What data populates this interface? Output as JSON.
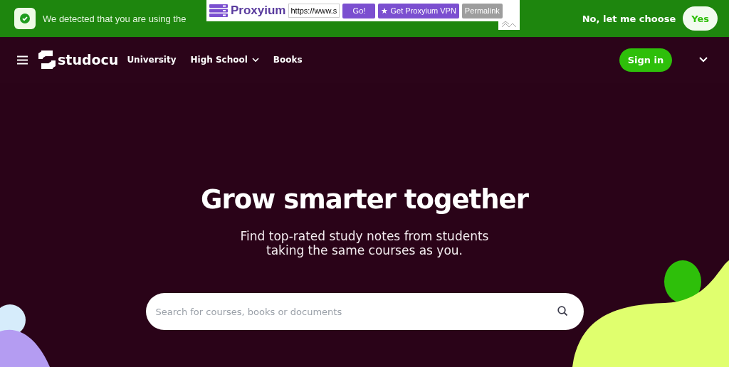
{
  "banner": {
    "message": "We detected that you are using the",
    "decline": "No, let me choose",
    "accept": "Yes"
  },
  "proxy_bar": {
    "brand": "Proxyium",
    "url": "https://www.s",
    "go": "Go!",
    "vpn": "★ Get Proxyium VPN",
    "permalink": "Permalink"
  },
  "nav": {
    "logo": "studocu",
    "links": [
      {
        "label": "University",
        "dropdown": false
      },
      {
        "label": "High School",
        "dropdown": true
      },
      {
        "label": "Books",
        "dropdown": false
      }
    ],
    "sign_in": "Sign in"
  },
  "hero": {
    "title": "Grow smarter together",
    "subtitle": "Find top-rated study notes from students taking the same courses as you.",
    "search": {
      "placeholder": "Search for courses, books or documents"
    }
  }
}
